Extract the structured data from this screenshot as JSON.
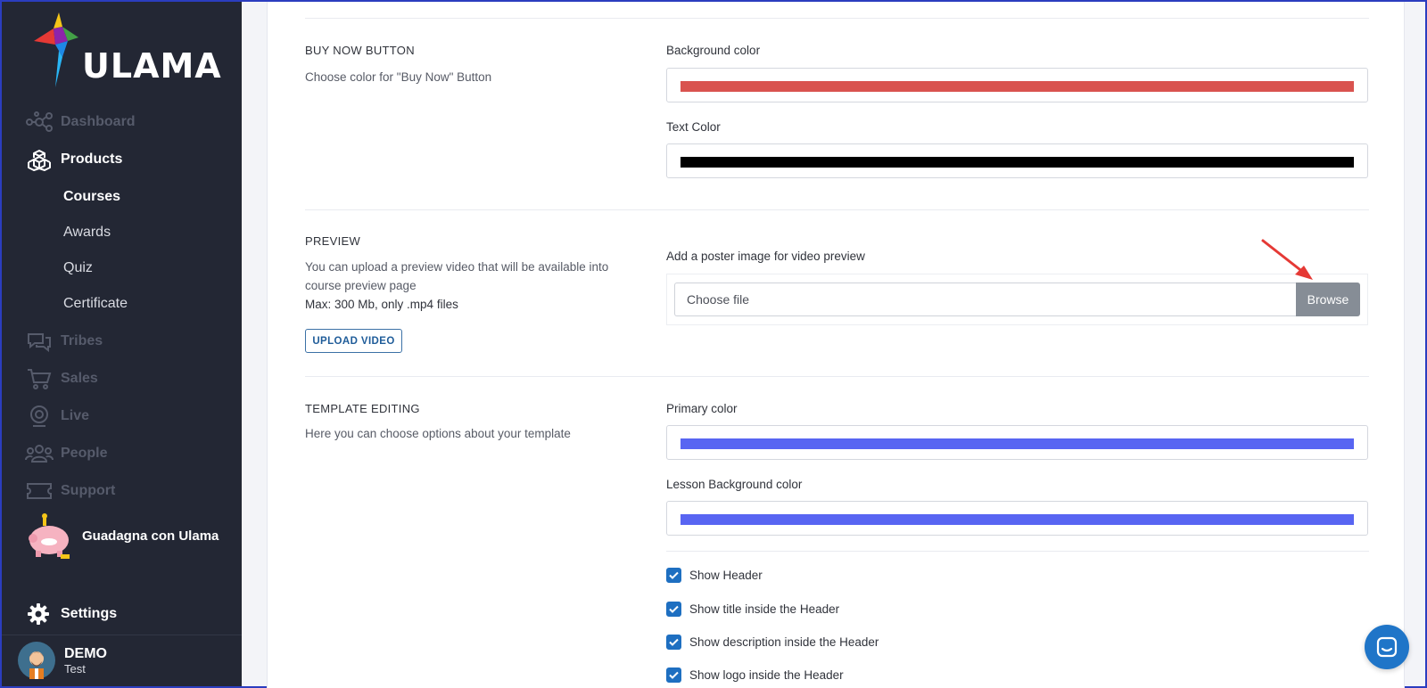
{
  "brand": {
    "name": "ULAMA"
  },
  "sidebar": {
    "items": [
      {
        "label": "Dashboard",
        "icon": "network-icon"
      },
      {
        "label": "Products",
        "icon": "boxes-icon"
      },
      {
        "label": "Tribes",
        "icon": "chat-bubbles-icon"
      },
      {
        "label": "Sales",
        "icon": "cart-icon"
      },
      {
        "label": "Live",
        "icon": "webcam-icon"
      },
      {
        "label": "People",
        "icon": "people-icon"
      },
      {
        "label": "Support",
        "icon": "ticket-icon"
      }
    ],
    "subitems": [
      "Courses",
      "Awards",
      "Quiz",
      "Certificate"
    ],
    "promo": "Guadagna con Ulama",
    "settings": "Settings",
    "user": {
      "name": "DEMO",
      "sub": "Test"
    }
  },
  "buy_now": {
    "title": "BUY NOW BUTTON",
    "desc": "Choose color for \"Buy Now\" Button",
    "bg_label": "Background color",
    "bg_color": "#d9534f",
    "text_label": "Text Color",
    "text_color": "#000000"
  },
  "preview": {
    "title": "PREVIEW",
    "desc": "You can upload a preview video that will be available into course preview page",
    "limit": "Max: 300 Mb, only .mp4 files",
    "upload_label": "UPLOAD VIDEO",
    "poster_label": "Add a poster image for video preview",
    "file_placeholder": "Choose file",
    "browse_label": "Browse"
  },
  "template": {
    "title": "TEMPLATE EDITING",
    "desc": "Here you can choose options about your template",
    "primary_label": "Primary color",
    "primary_color": "#5865f2",
    "lesson_label": "Lesson Background color",
    "lesson_color": "#5865f2",
    "checks": [
      "Show Header",
      "Show title inside the Header",
      "Show description inside the Header",
      "Show logo inside the Header"
    ]
  }
}
